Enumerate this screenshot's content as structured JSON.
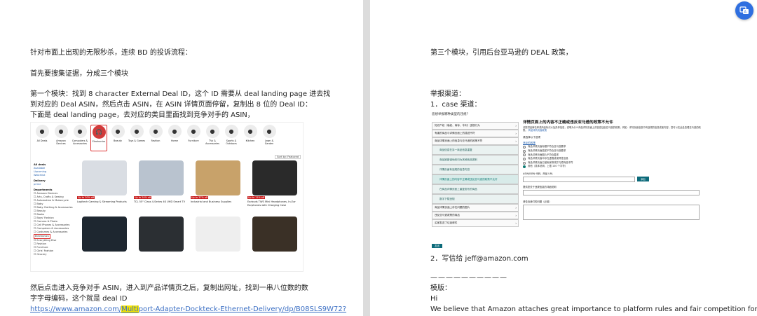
{
  "left_page": {
    "p1": "针对市面上出现的无限秒杀，连续 BD 的投诉流程：",
    "p2": "首先要搜集证据，分成三个模块",
    "p3_line1": "第一个模块：找到 8 character External Deal ID，这个 ID 需要从 deal landing page 进去找",
    "p3_line2": "到对应的 Deal ASIN，然后点击 ASIN，在 ASIN 详情页面停留，复制出 8 位的 Deal ID：",
    "p3_line3": "下面是 deal landing page，去对应的类目里面找到竞争对手的 ASIN，",
    "p4_line1": "然后点击进入竞争对手 ASIN，进入到产品详情页之后，复制出网址，找到一串八位数的数",
    "p4_line2": "字字母编码，这个就是 deal ID",
    "link_prefix": "https://www.amazon.com/",
    "link_highlight": "Multi",
    "link_suffix": "port-Adapter-Dockteck-Ethernet-Delivery/dp/B08SLS9W72?"
  },
  "right_page": {
    "p1": "第三个模块，引用后台亚马逊的 DEAL 政策，",
    "p2": "举报渠道：",
    "p3": "1．case 渠道：",
    "p4": "2．写信给 jeff@amazon.com",
    "divider": "——————————",
    "p5": "模版：",
    "p6": "Hi",
    "p7": "We believe that Amazon attaches great importance to platform rules and fair competition for"
  },
  "amazon_screenshot": {
    "categories": [
      {
        "label": "All Deals",
        "icon": "●"
      },
      {
        "label": "Amazon Devices",
        "icon": "●"
      },
      {
        "label": "Computers & Accessories",
        "icon": "●"
      },
      {
        "label": "Electronics",
        "icon": "🎧"
      },
      {
        "label": "Beauty",
        "icon": "●"
      },
      {
        "label": "Toys & Games",
        "icon": "●"
      },
      {
        "label": "Fashion",
        "icon": "●"
      },
      {
        "label": "Home",
        "icon": "●"
      },
      {
        "label": "Furniture",
        "icon": "●"
      },
      {
        "label": "TVs & Accessories",
        "icon": "●"
      },
      {
        "label": "Sports & Outdoors",
        "icon": "●"
      },
      {
        "label": "Kitchen",
        "icon": "●"
      },
      {
        "label": "Lawn & Garden",
        "icon": "●"
      }
    ],
    "sort_label": "Sort by: Featured",
    "sidebar": {
      "availability": "All deals",
      "avail_items": [
        "Available",
        "Upcoming",
        "Watchlist"
      ],
      "delivery": "Delivery",
      "prime": "prime",
      "departments": "Departments",
      "dept_items": [
        "Amazon Devices",
        "Arts, Crafts & Sewing",
        "Automotive & Motorcycle",
        "Baby",
        "Baby Clothing & Accessories",
        "Beauty",
        "Books",
        "Boys' Fashion",
        "Camera & Photo",
        "Cell Phones & Accessories",
        "Computers & Accessories",
        "Costumes & Accessories"
      ],
      "dept_selected": "Electronics",
      "dept_items_2": [
        "Everything Else",
        "Fashion",
        "Furniture",
        "Girls' Fashion",
        "Grocery"
      ]
    },
    "products": [
      {
        "text": "Logitech Gaming & Streaming Products",
        "badge": "Up to 20% off",
        "color": "#d9dde3"
      },
      {
        "text": "TCL 55\" Class 4-Series 4K UHD Smart TV",
        "badge": "Up to 24% off",
        "color": "#b9c3cf"
      },
      {
        "text": "Industrial and Business Supplies",
        "badge": "Up to 37% off",
        "color": "#c8a26a"
      },
      {
        "text": "Earbuds TWS Mini Headphones, In-Ear Earphones with Charging Case",
        "badge": "Up to 11% off",
        "color": "#2a2a2a"
      },
      {
        "text": "",
        "badge": "",
        "color": "#1e2730"
      },
      {
        "text": "",
        "badge": "",
        "color": "#2b2f33"
      },
      {
        "text": "",
        "badge": "",
        "color": "#eeeeee"
      },
      {
        "text": "",
        "badge": "",
        "color": "#3a3026"
      }
    ]
  },
  "report_form": {
    "title": "您想举报哪种类型的违规？",
    "menu": [
      {
        "label": "知识产权（版权、商标、专利）违规行为",
        "type": "top"
      },
      {
        "label": "有害的商品与详情页面上的描述不符",
        "type": "top"
      },
      {
        "label": "商品详情页面上的信息与亚马逊的政策不符",
        "type": "top"
      },
      {
        "label": "商品信息在另一商品信息重复",
        "type": "sub"
      },
      {
        "label": "商品被错误地划归为其他商品类别",
        "type": "sub"
      },
      {
        "label": "详情页面有违规的信息内容",
        "type": "sub"
      },
      {
        "label": "详情页面上的内容不正确或违反亚马逊的政策不允许",
        "type": "sub-active"
      },
      {
        "label": "在商品详情页面上重复发布的商品",
        "type": "sub"
      },
      {
        "label": "数字下载违规",
        "type": "sub"
      },
      {
        "label": "商品详情页面上存在问题的图片",
        "type": "top"
      },
      {
        "label": "违反亚马逊政策的商品",
        "type": "top"
      },
      {
        "label": "买家发送了垃圾邮件",
        "type": "top"
      }
    ],
    "detail_title": "详情页面上的内容不正确或违反亚马逊的政策不允许",
    "detail_desc": "请提供品牌名称或商品标识以及具体信息，说明为什么商品详情页面上的信息违反亚马逊的政策。例如：详情页面信息中有违规的信息或者内容。您可以在此处查看亚马逊的政策。",
    "detail_link": "商品详情页面政策",
    "section_label": "请选择以下选项",
    "section_header": "违反的政策",
    "radios": [
      {
        "label": "商品详情页面标题不符合亚马逊要求",
        "on": false
      },
      {
        "label": "商品详情页面描述不符合亚马逊要求",
        "on": false
      },
      {
        "label": "商品详情页面图片不符合要求",
        "on": false
      },
      {
        "label": "商品详情页面中存在虚假或误导性信息",
        "on": false
      },
      {
        "label": "商品详情页面已被卖家修改并与原商品不符",
        "on": false
      },
      {
        "label": "其他（具体说明，上限 100 个字符）",
        "on": true
      }
    ],
    "asin_label": "ASIN/ISBN 代码，商品 URL",
    "add_button": "添加",
    "field2_label": "提供您关于违规信息的详细说明",
    "field3_label": "请告诉我们的问题（必填）",
    "submit_button": "发送"
  }
}
